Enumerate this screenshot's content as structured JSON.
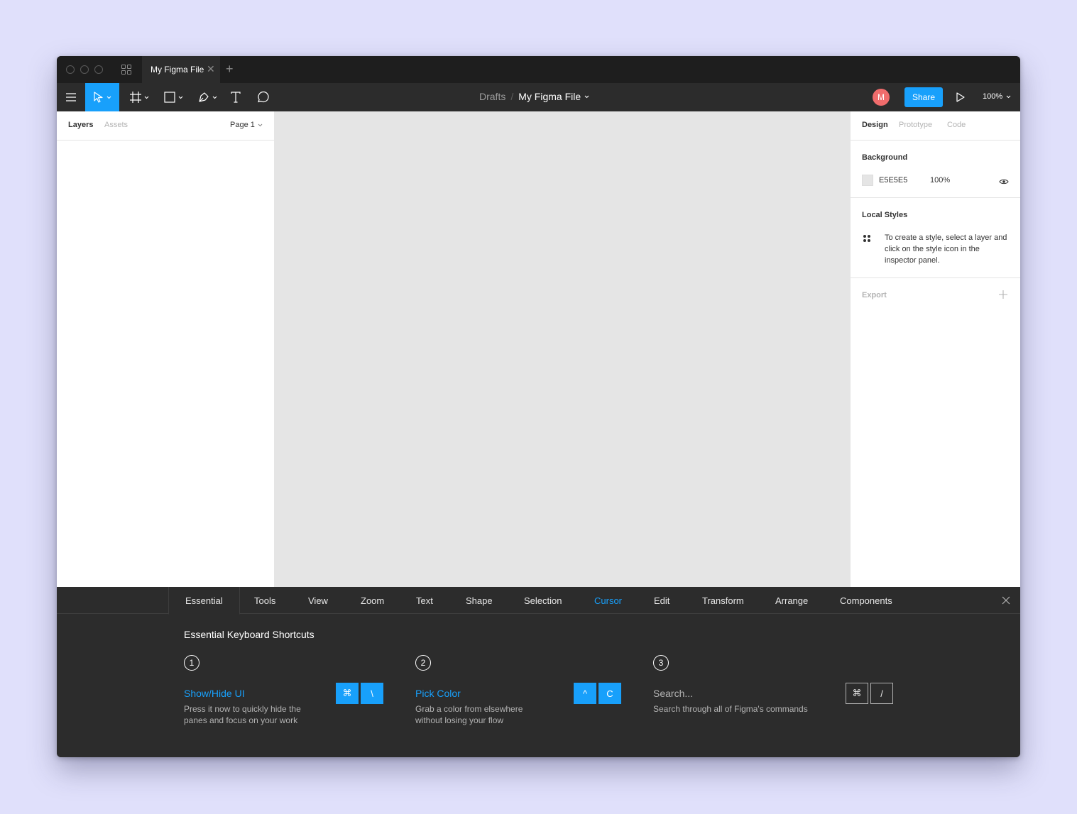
{
  "titlebar": {
    "tab_title": "My Figma File"
  },
  "toolbar": {
    "breadcrumb_parent": "Drafts",
    "breadcrumb_separator": "/",
    "file_name": "My Figma File",
    "avatar_initial": "M",
    "share_label": "Share",
    "zoom_level": "100%"
  },
  "left_panel": {
    "tab_layers": "Layers",
    "tab_assets": "Assets",
    "page_selector": "Page 1"
  },
  "right_panel": {
    "tabs": [
      "Design",
      "Prototype",
      "Code"
    ],
    "background_title": "Background",
    "background_hex": "E5E5E5",
    "background_opacity": "100%",
    "local_styles_title": "Local Styles",
    "local_styles_desc": "To create a style, select a layer and click on the style icon in the inspector panel.",
    "export_title": "Export"
  },
  "shortcuts": {
    "tabs": [
      "Essential",
      "Tools",
      "View",
      "Zoom",
      "Text",
      "Shape",
      "Selection",
      "Cursor",
      "Edit",
      "Transform",
      "Arrange",
      "Components"
    ],
    "title": "Essential Keyboard Shortcuts",
    "items": [
      {
        "step": "1",
        "name": "Show/Hide UI",
        "desc": "Press it now to quickly hide the panes and focus on your work",
        "keys": [
          "⌘",
          "\\"
        ]
      },
      {
        "step": "2",
        "name": "Pick Color",
        "desc": "Grab a color from elsewhere without losing your flow",
        "keys": [
          "^",
          "C"
        ]
      },
      {
        "step": "3",
        "name": "Search...",
        "desc": "Search through all of Figma's commands",
        "keys": [
          "⌘",
          "/"
        ]
      }
    ]
  },
  "colors": {
    "accent": "#18a0fb",
    "toolbar_bg": "#2c2c2c",
    "canvas_bg": "#e5e5e5",
    "avatar": "#f06c6c",
    "page_bg": "#e0e0fb"
  },
  "icons": [
    "menu-icon",
    "move-icon",
    "frame-icon",
    "rectangle-icon",
    "pen-icon",
    "text-icon",
    "comment-icon",
    "play-icon",
    "eye-icon",
    "styles-icon",
    "plus-icon",
    "close-icon",
    "grid-icon"
  ]
}
